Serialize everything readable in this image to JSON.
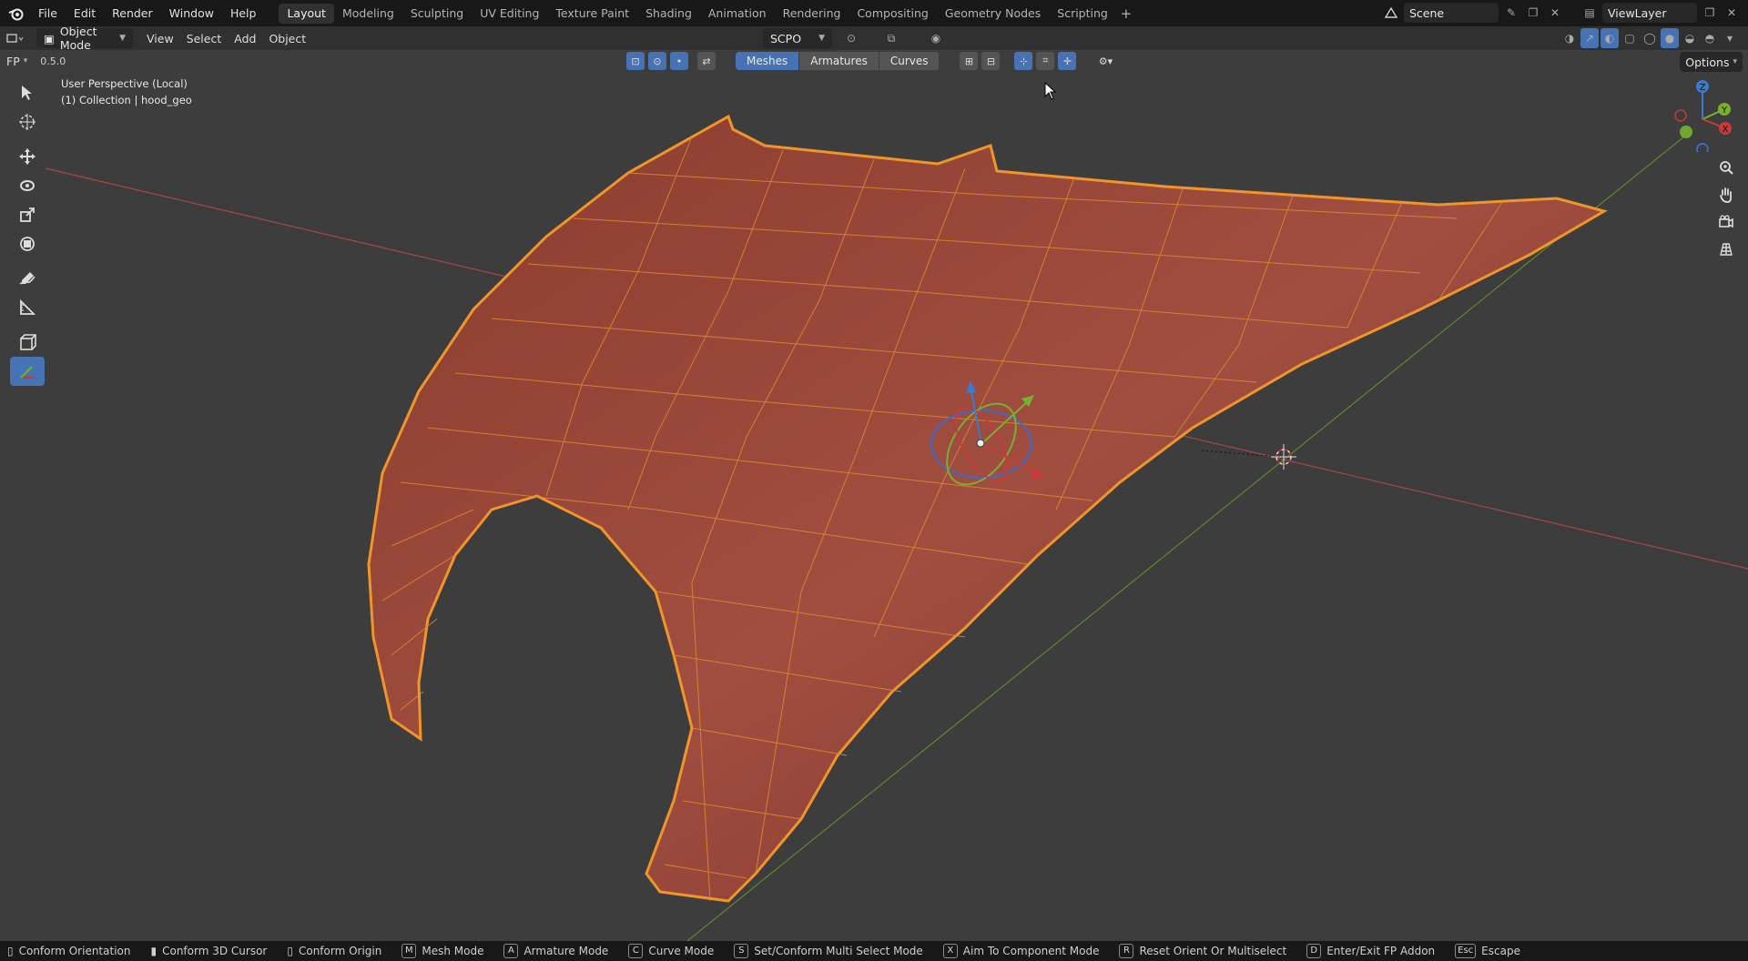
{
  "menu": [
    "File",
    "Edit",
    "Render",
    "Window",
    "Help"
  ],
  "workspaces": [
    "Layout",
    "Modeling",
    "Sculpting",
    "UV Editing",
    "Texture Paint",
    "Shading",
    "Animation",
    "Rendering",
    "Compositing",
    "Geometry Nodes",
    "Scripting"
  ],
  "active_workspace": "Layout",
  "add_workspace": "+",
  "scene": {
    "name": "Scene"
  },
  "view_layer": {
    "name": "ViewLayer"
  },
  "header": {
    "mode": "Object Mode",
    "view": "View",
    "select": "Select",
    "add": "Add",
    "object": "Object",
    "orientation": "SCPO",
    "options": "Options"
  },
  "addon_bar": {
    "label": "FP",
    "value": "0.5.0",
    "segments": [
      "Meshes",
      "Armatures",
      "Curves"
    ],
    "active_segment": "Meshes"
  },
  "viewport": {
    "perspective": "User Perspective (Local)",
    "collection": "(1) Collection | hood_geo",
    "gizmo_axes": {
      "x": "X",
      "y": "Y",
      "z": "Z"
    },
    "colors": {
      "mesh_fill": "#a04a3a",
      "wire": "#f0952a",
      "x_axis": "#b84a4a",
      "y_axis": "#6a9a30",
      "z_axis": "#3a7ad0"
    }
  },
  "status": [
    {
      "key": "",
      "label": "Conform Orientation"
    },
    {
      "key": "",
      "label": "Conform 3D Cursor"
    },
    {
      "key": "",
      "label": "Conform Origin"
    },
    {
      "key": "M",
      "label": "Mesh Mode"
    },
    {
      "key": "A",
      "label": "Armature Mode"
    },
    {
      "key": "C",
      "label": "Curve Mode"
    },
    {
      "key": "S",
      "label": "Set/Conform Multi Select Mode"
    },
    {
      "key": "X",
      "label": "Aim To Component Mode"
    },
    {
      "key": "R",
      "label": "Reset Orient Or Multiselect"
    },
    {
      "key": "D",
      "label": "Enter/Exit FP Addon"
    },
    {
      "key": "Esc",
      "label": "Escape"
    }
  ]
}
